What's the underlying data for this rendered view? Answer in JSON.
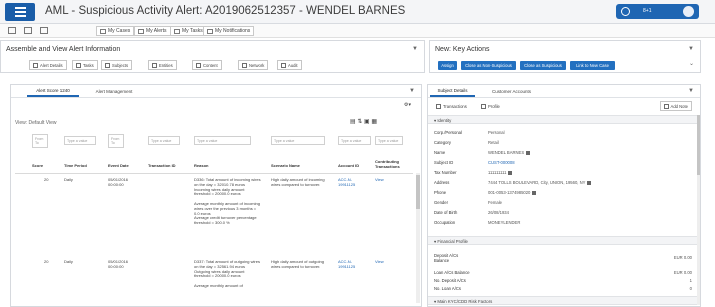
{
  "header": {
    "title": "AML - Suspicious Activity Alert: A2019062512357 - WENDEL BARNES",
    "user_label": "8+1",
    "toolbar_items": [
      {
        "label": "My Cases",
        "icon": "briefcase-icon"
      },
      {
        "label": "My Alerts",
        "icon": "alert-icon"
      },
      {
        "label": "My Tasks",
        "icon": "tasks-icon"
      },
      {
        "label": "My Notifications",
        "icon": "bell-icon"
      }
    ]
  },
  "assemble_panel": {
    "title": "Assemble and View Alert Information",
    "buttons": [
      {
        "label": "Alert Details"
      },
      {
        "label": "Tasks"
      },
      {
        "label": "Subjects"
      },
      {
        "label": "Entities"
      },
      {
        "label": "Content"
      },
      {
        "label": "Network"
      },
      {
        "label": "Audit"
      }
    ]
  },
  "actions_panel": {
    "title": "New: Key Actions",
    "buttons": [
      "Assign",
      "Close as Non-Suspicious",
      "Close as Suspicious",
      "Link to New Case"
    ]
  },
  "alert_panel": {
    "tabs": [
      {
        "label": "Alert Score 1240"
      },
      {
        "label": "Alert Management"
      }
    ],
    "view_label": "View: Default View",
    "filter_placeholder": "Type a value",
    "filter_from": "From",
    "filter_to": "To",
    "columns": [
      "Score",
      "Time Period",
      "Event Date",
      "Transaction ID",
      "Reason",
      "Scenario Name",
      "Account ID",
      "Contributing Transactions"
    ],
    "rows": [
      {
        "score": "20",
        "period": "Daily",
        "date": "05/01/2016 00:00:00",
        "txn": "",
        "reason": "D336: Total amount of incoming wires on the day = 32010.78 euros\nIncoming wires daily amount threshold = 20000.0 euros\n\nAverage monthly amount of incoming wires over the previous 3 months = 0.0 euros\nAverage credit turnover percentage threshold = 300.0 %",
        "scenario": "High daily amount of incoming wires compared to turnover.",
        "account": "ACC-N-19911125",
        "link": "View"
      },
      {
        "score": "20",
        "period": "Daily",
        "date": "05/01/2016 00:00:00",
        "txn": "",
        "reason": "D337: Total amount of outgoing wires on the day = 32561.94 euros\nOutgoing wires daily amount threshold = 20000.0 euros\n\nAverage monthly amount of",
        "scenario": "High daily amount of outgoing wires compared to turnover.",
        "account": "ACC-N-19911125",
        "link": "View"
      }
    ]
  },
  "subject_panel": {
    "tabs": [
      {
        "label": "Subject Details"
      },
      {
        "label": "Customer Accounts"
      }
    ],
    "sub_buttons": [
      {
        "label": "Transactions"
      },
      {
        "label": "Profile"
      }
    ],
    "add_note": "Add Note",
    "identity_section": "Identity",
    "fields": [
      {
        "key": "Corp./Personal",
        "value": "Personal",
        "link": false,
        "flag": false
      },
      {
        "key": "Category",
        "value": "Retail",
        "link": false,
        "flag": false
      },
      {
        "key": "Name",
        "value": "WENDEL BARNES",
        "link": false,
        "flag": true
      },
      {
        "key": "Subject ID",
        "value": "CUST-000008",
        "link": true,
        "flag": false
      },
      {
        "key": "Tax Number",
        "value": "111111111",
        "link": false,
        "flag": true
      },
      {
        "key": "Address",
        "value": "7444 TOLLS BOULEVARD, City, UNION, 19560, NY",
        "link": false,
        "flag": true
      },
      {
        "key": "Phone",
        "value": "001-0053-1374985020",
        "link": false,
        "flag": true
      },
      {
        "key": "Gender",
        "value": "Female",
        "link": false,
        "flag": false
      },
      {
        "key": "Date of Birth",
        "value": "26/08/1934",
        "link": false,
        "flag": false
      },
      {
        "key": "Occupation",
        "value": "MONEYLENDER",
        "link": false,
        "flag": false
      }
    ],
    "financial_section": "Financial Profile",
    "financial": [
      {
        "key": "Deposit A/Cs Balance",
        "value": "EUR 0.00"
      },
      {
        "key": "Loan A/Cs Balance",
        "value": "EUR 0.00"
      },
      {
        "key": "No. Deposit A/Cs",
        "value": "1"
      },
      {
        "key": "No. Loan A/Cs",
        "value": "0"
      }
    ],
    "risk_section": "Main KYC/CDD Risk Factors"
  },
  "colors": {
    "brand": "#1f66b3",
    "link": "#1f66b3"
  }
}
